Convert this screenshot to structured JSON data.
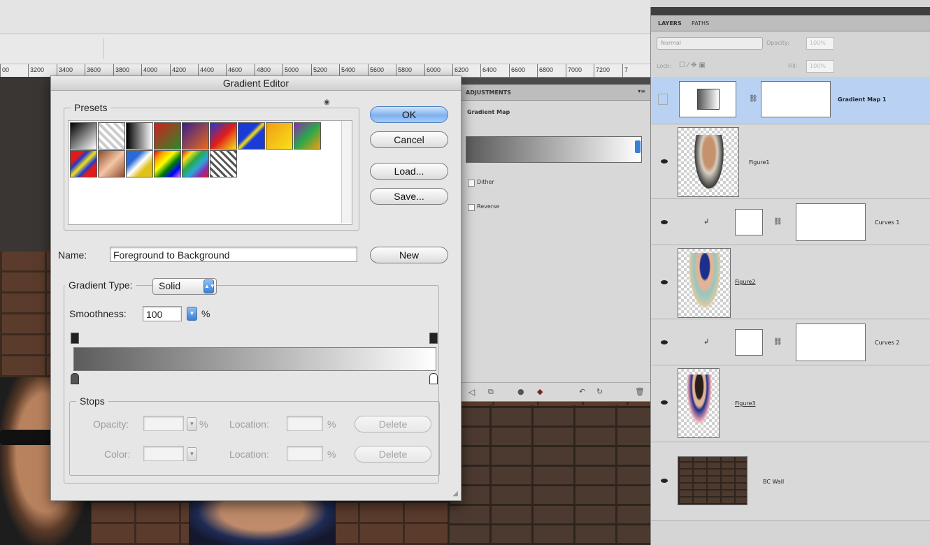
{
  "ruler": {
    "labels": [
      "00",
      "3200",
      "3400",
      "3600",
      "3800",
      "4000",
      "4200",
      "4400",
      "4600",
      "4800",
      "5000",
      "5200",
      "5400",
      "5600",
      "5800",
      "6000",
      "6200",
      "6400",
      "6600",
      "6800",
      "7000",
      "7200",
      "7"
    ]
  },
  "gradient_editor": {
    "title": "Gradient Editor",
    "presets_label": "Presets",
    "buttons": {
      "ok": "OK",
      "cancel": "Cancel",
      "load": "Load...",
      "save": "Save...",
      "new": "New"
    },
    "name_label": "Name:",
    "name_value": "Foreground to Background",
    "gradient_type_label": "Gradient Type:",
    "gradient_type_value": "Solid",
    "smoothness_label": "Smoothness:",
    "smoothness_value": "100",
    "percent": "%",
    "stops": {
      "label": "Stops",
      "opacity_label": "Opacity:",
      "location_label": "Location:",
      "color_label": "Color:",
      "delete_label": "Delete",
      "percent": "%"
    },
    "preset_swatches": [
      "linear-gradient(135deg,#000,#fff)",
      "repeating-linear-gradient(45deg,#ccc 0 4px,#fff 4px 8px)",
      "linear-gradient(90deg,#000,#fff)",
      "linear-gradient(135deg,#d21f1f,#2a8a2a)",
      "linear-gradient(135deg,#3b1e8c,#e86b1a)",
      "linear-gradient(135deg,#1a3bd6,#e01b1b,#f7e21a)",
      "linear-gradient(135deg,#1a3bd6 40%,#f7e21a 50%,#1a3bd6 60%)",
      "linear-gradient(135deg,#f39c12,#f7e21a)",
      "linear-gradient(135deg,#8e2bb0,#2aa84a,#f39c12)",
      "linear-gradient(135deg,#e01b1b 25%,#1a3bd6 35%,#f7e21a 50%,#1a3bd6 65%,#e01b1b 75%)",
      "linear-gradient(135deg,#8b4a2b,#f5c6a5,#8b4a2b)",
      "linear-gradient(135deg,#2a6ad6 30%,#fff 50%,#e0c21b 70%)",
      "linear-gradient(135deg,red,orange,yellow,green,blue,violet)",
      "linear-gradient(135deg,#e01b1b,#f7e21a,#2aa84a,#2aa8d6,#8e2bb0,#e01b1b)",
      "repeating-linear-gradient(45deg,#555 0 3px,#fff 3px 7px)"
    ]
  },
  "adjustments": {
    "tab": "ADJUSTMENTS",
    "title": "Gradient Map",
    "dither": "Dither",
    "reverse": "Reverse"
  },
  "layers_panel": {
    "tabs": [
      "LAYERS",
      "PATHS"
    ],
    "blend_mode": "Normal",
    "opacity_label": "Opacity:",
    "opacity_value": "100%",
    "lock_label": "Lock:",
    "fill_label": "Fill:",
    "fill_value": "100%",
    "layers": [
      {
        "name": "Gradient Map 1",
        "selected": true
      },
      {
        "name": "Figure1"
      },
      {
        "name": "Curves 1"
      },
      {
        "name": "Figure2"
      },
      {
        "name": "Curves 2"
      },
      {
        "name": "Figure3"
      },
      {
        "name": "BC Wall"
      }
    ]
  }
}
